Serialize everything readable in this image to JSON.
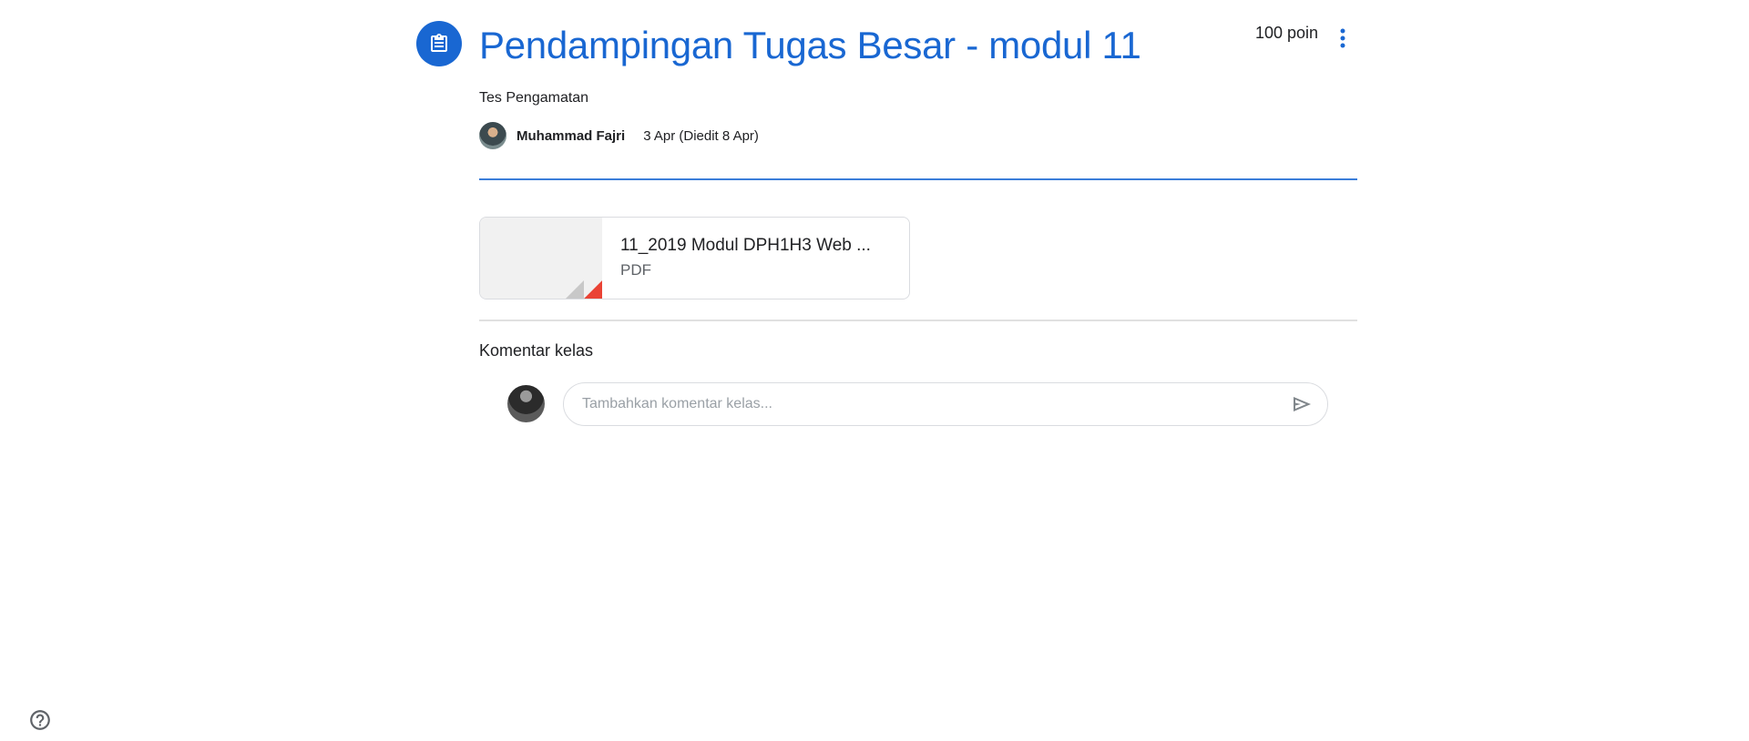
{
  "assignment": {
    "icon": "assignment-clipboard-icon",
    "title": "Pendampingan Tugas Besar - modul 11",
    "points": "100 poin",
    "more_icon": "more-vertical-icon",
    "description": "Tes Pengamatan",
    "author": "Muhammad Fajri",
    "date": "3 Apr (Diedit 8 Apr)"
  },
  "attachment": {
    "name": "11_2019 Modul DPH1H3 Web ...",
    "type": "PDF",
    "icon": "pdf-file-icon"
  },
  "comments": {
    "heading": "Komentar kelas",
    "placeholder": "Tambahkan komentar kelas...",
    "send_icon": "send-icon"
  },
  "help_icon": "help-circle-icon",
  "colors": {
    "accent": "#1967d2",
    "pdf_red": "#ea4335",
    "border": "#dadce0",
    "divider": "#e0e0e0"
  }
}
